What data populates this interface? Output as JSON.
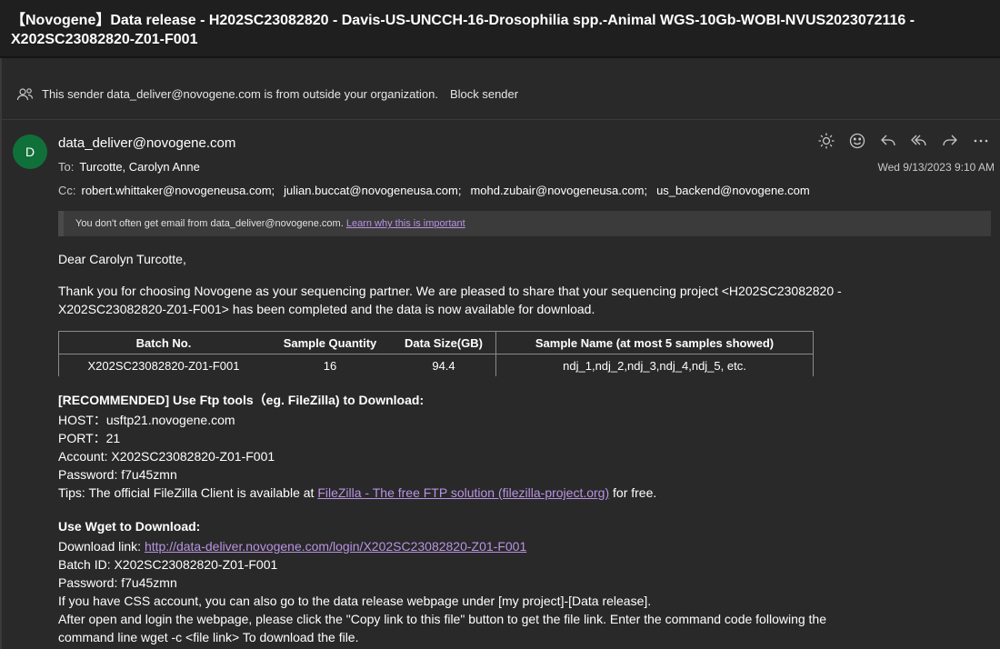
{
  "subject": "【Novogene】Data release - H202SC23082820 - Davis-US-UNCCH-16-Drosophilia spp.-Animal WGS-10Gb-WOBI-NVUS2023072116 - X202SC23082820-Z01-F001",
  "external_warning": {
    "text": "This sender data_deliver@novogene.com is from outside your organization.",
    "block_label": "Block sender"
  },
  "email": {
    "avatar_initial": "D",
    "sender": "data_deliver@novogene.com",
    "to_label": "To:",
    "to": "Turcotte, Carolyn Anne",
    "cc_label": "Cc:",
    "cc": [
      "robert.whittaker@novogeneusa.com;",
      "julian.buccat@novogeneusa.com;",
      "mohd.zubair@novogeneusa.com;",
      "us_backend@novogene.com"
    ],
    "date": "Wed 9/13/2023 9:10 AM"
  },
  "notice": {
    "text": "You don't often get email from data_deliver@novogene.com.",
    "link": "Learn why this is important"
  },
  "body": {
    "greeting": "Dear Carolyn Turcotte,",
    "intro": "Thank you for choosing Novogene as your sequencing partner. We are pleased to share that your sequencing project <H202SC23082820 - X202SC23082820-Z01-F001> has been completed and the data is now available for download."
  },
  "table": {
    "headers": [
      "Batch No.",
      "Sample Quantity",
      "Data Size(GB)",
      "Sample Name (at most 5 samples showed)"
    ],
    "row": [
      "X202SC23082820-Z01-F001",
      "16",
      "94.4",
      "ndj_1,ndj_2,ndj_3,ndj_4,ndj_5, etc."
    ]
  },
  "ftp": {
    "heading": "[RECOMMENDED] Use Ftp tools（eg. FileZilla) to Download:",
    "host": "HOST：usftp21.novogene.com",
    "port": "PORT：21",
    "account": "Account: X202SC23082820-Z01-F001",
    "password": "Password: f7u45zmn",
    "tips_prefix": "Tips: The official FileZilla Client is available at",
    "tips_link": "FileZilla - The free FTP solution (filezilla-project.org)",
    "tips_suffix": "for free."
  },
  "wget": {
    "heading": "Use Wget to Download:",
    "link_prefix": "Download link:",
    "link": "http://data-deliver.novogene.com/login/X202SC23082820-Z01-F001",
    "batch": "Batch ID: X202SC23082820-Z01-F001",
    "password": "Password: f7u45zmn",
    "css_note": "If you have CSS account, you can also go to the data release webpage under [my project]-[Data release].",
    "instructions": "After open and login the webpage, please click the \"Copy link to this file\" button to get the file link. Enter the command code following the command line wget -c <file link> To download the file."
  },
  "actions": [
    "sun-icon",
    "emoji-icon",
    "reply-icon",
    "reply-all-icon",
    "forward-icon",
    "more-icon"
  ]
}
